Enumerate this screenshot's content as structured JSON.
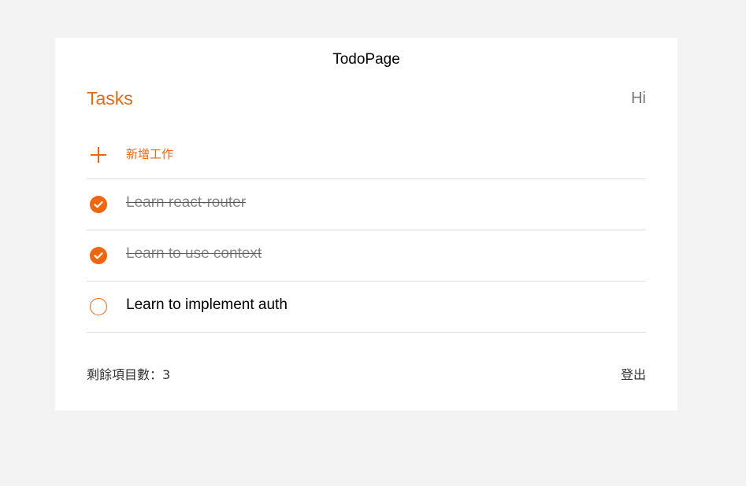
{
  "page_title": "TodoPage",
  "header": {
    "tasks_label": "Tasks",
    "greeting": "Hi"
  },
  "add_task": {
    "label": "新增工作",
    "icon": "plus-icon"
  },
  "tasks": [
    {
      "text": "Learn react-router",
      "done": true
    },
    {
      "text": "Learn to use context",
      "done": true
    },
    {
      "text": "Learn to implement auth",
      "done": false
    }
  ],
  "footer": {
    "remaining_label": "剩餘項目數：3",
    "logout_label": "登出"
  },
  "colors": {
    "accent": "#f0660e",
    "background": "#f3f3f3",
    "card": "#ffffff"
  }
}
